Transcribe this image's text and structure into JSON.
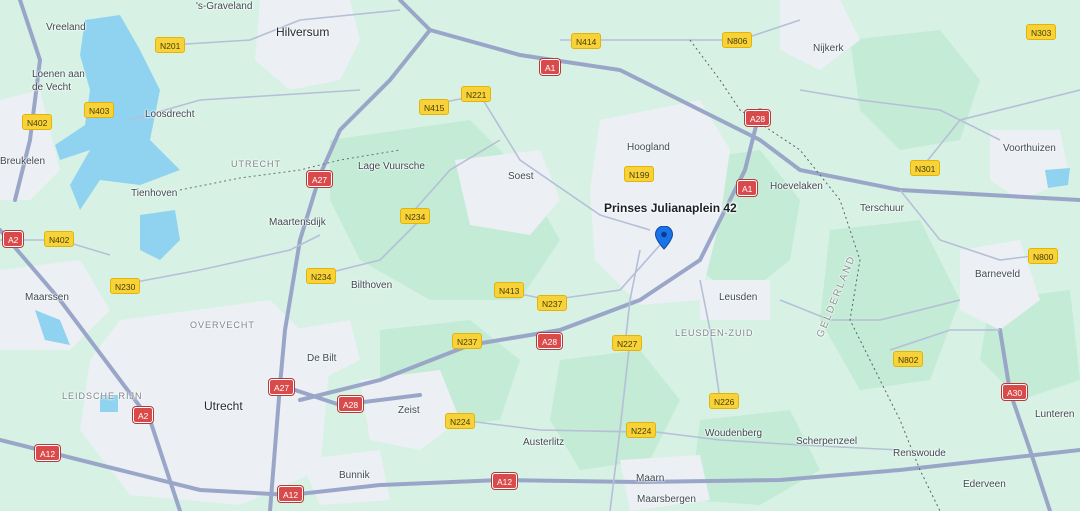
{
  "marker": {
    "label": "Prinses Julianaplein 42"
  },
  "places": [
    {
      "id": "vreeland",
      "text": "Vreeland",
      "cls": "lbl"
    },
    {
      "id": "graveland",
      "text": "'s-Graveland",
      "cls": "lbl"
    },
    {
      "id": "hilversum",
      "text": "Hilversum",
      "cls": "lbl city"
    },
    {
      "id": "nijkerk",
      "text": "Nijkerk",
      "cls": "lbl"
    },
    {
      "id": "loenen",
      "text": "Loenen aan\nde Vecht",
      "cls": "lbl"
    },
    {
      "id": "loosdrecht",
      "text": "Loosdrecht",
      "cls": "lbl"
    },
    {
      "id": "hoogland",
      "text": "Hoogland",
      "cls": "lbl"
    },
    {
      "id": "voorthuizen",
      "text": "Voorthuizen",
      "cls": "lbl"
    },
    {
      "id": "breukelen",
      "text": "Breukelen",
      "cls": "lbl"
    },
    {
      "id": "utrecht-prov",
      "text": "UTRECHT",
      "cls": "lbl region"
    },
    {
      "id": "lagevuursche",
      "text": "Lage Vuursche",
      "cls": "lbl"
    },
    {
      "id": "soest",
      "text": "Soest",
      "cls": "lbl"
    },
    {
      "id": "tienhoven",
      "text": "Tienhoven",
      "cls": "lbl"
    },
    {
      "id": "hoevelaken",
      "text": "Hoevelaken",
      "cls": "lbl"
    },
    {
      "id": "terschuur",
      "text": "Terschuur",
      "cls": "lbl"
    },
    {
      "id": "maartensdijk",
      "text": "Maartensdijk",
      "cls": "lbl"
    },
    {
      "id": "barneveld",
      "text": "Barneveld",
      "cls": "lbl"
    },
    {
      "id": "maarssen",
      "text": "Maarssen",
      "cls": "lbl"
    },
    {
      "id": "bilthoven",
      "text": "Bilthoven",
      "cls": "lbl"
    },
    {
      "id": "leusden",
      "text": "Leusden",
      "cls": "lbl"
    },
    {
      "id": "overvecht",
      "text": "OVERVECHT",
      "cls": "lbl region"
    },
    {
      "id": "leusdenzuid",
      "text": "LEUSDEN-ZUID",
      "cls": "lbl region"
    },
    {
      "id": "debilt",
      "text": "De Bilt",
      "cls": "lbl"
    },
    {
      "id": "leidscherijn",
      "text": "LEIDSCHE RIJN",
      "cls": "lbl region"
    },
    {
      "id": "utrecht",
      "text": "Utrecht",
      "cls": "lbl city"
    },
    {
      "id": "zeist",
      "text": "Zeist",
      "cls": "lbl"
    },
    {
      "id": "lunteren",
      "text": "Lunteren",
      "cls": "lbl"
    },
    {
      "id": "woudenberg",
      "text": "Woudenberg",
      "cls": "lbl"
    },
    {
      "id": "scherpenzeel",
      "text": "Scherpenzeel",
      "cls": "lbl"
    },
    {
      "id": "austerlitz",
      "text": "Austerlitz",
      "cls": "lbl"
    },
    {
      "id": "renswoude",
      "text": "Renswoude",
      "cls": "lbl"
    },
    {
      "id": "bunnik",
      "text": "Bunnik",
      "cls": "lbl"
    },
    {
      "id": "maarn",
      "text": "Maarn",
      "cls": "lbl"
    },
    {
      "id": "maarsbergen",
      "text": "Maarsbergen",
      "cls": "lbl"
    },
    {
      "id": "ederveen",
      "text": "Ederveen",
      "cls": "lbl"
    },
    {
      "id": "gelderland",
      "text": "GELDERLAND",
      "cls": "lbl prov"
    }
  ],
  "shields": [
    {
      "id": "s1",
      "text": "N201",
      "kind": "n"
    },
    {
      "id": "s2",
      "text": "N414",
      "kind": "n"
    },
    {
      "id": "s3",
      "text": "N806",
      "kind": "n"
    },
    {
      "id": "s4",
      "text": "N303",
      "kind": "n"
    },
    {
      "id": "s5",
      "text": "A1",
      "kind": "a"
    },
    {
      "id": "s6",
      "text": "N403",
      "kind": "n"
    },
    {
      "id": "s7",
      "text": "N221",
      "kind": "n"
    },
    {
      "id": "s8",
      "text": "N415",
      "kind": "n"
    },
    {
      "id": "s9",
      "text": "N402",
      "kind": "n"
    },
    {
      "id": "s10",
      "text": "A28",
      "kind": "a"
    },
    {
      "id": "s11",
      "text": "N199",
      "kind": "n"
    },
    {
      "id": "s12",
      "text": "N301",
      "kind": "n"
    },
    {
      "id": "s13",
      "text": "A27",
      "kind": "a"
    },
    {
      "id": "s14",
      "text": "A1",
      "kind": "a"
    },
    {
      "id": "s15",
      "text": "N234",
      "kind": "n"
    },
    {
      "id": "s16",
      "text": "A2",
      "kind": "a"
    },
    {
      "id": "s17",
      "text": "N402",
      "kind": "n"
    },
    {
      "id": "s18",
      "text": "N800",
      "kind": "n"
    },
    {
      "id": "s19",
      "text": "N234",
      "kind": "n"
    },
    {
      "id": "s20",
      "text": "N230",
      "kind": "n"
    },
    {
      "id": "s21",
      "text": "N413",
      "kind": "n"
    },
    {
      "id": "s22",
      "text": "N237",
      "kind": "n"
    },
    {
      "id": "s23",
      "text": "N237",
      "kind": "n"
    },
    {
      "id": "s24",
      "text": "A28",
      "kind": "a"
    },
    {
      "id": "s25",
      "text": "N227",
      "kind": "n"
    },
    {
      "id": "s26",
      "text": "N802",
      "kind": "n"
    },
    {
      "id": "s27",
      "text": "A27",
      "kind": "a"
    },
    {
      "id": "s28",
      "text": "A28",
      "kind": "a"
    },
    {
      "id": "s29",
      "text": "A30",
      "kind": "a"
    },
    {
      "id": "s30",
      "text": "N226",
      "kind": "n"
    },
    {
      "id": "s31",
      "text": "A2",
      "kind": "a"
    },
    {
      "id": "s32",
      "text": "N224",
      "kind": "n"
    },
    {
      "id": "s33",
      "text": "N224",
      "kind": "n"
    },
    {
      "id": "s34",
      "text": "A12",
      "kind": "a"
    },
    {
      "id": "s35",
      "text": "A12",
      "kind": "a"
    },
    {
      "id": "s36",
      "text": "A12",
      "kind": "a"
    }
  ],
  "colors": {
    "land": "#d7f2e4",
    "forest": "#bfe9d2",
    "urban": "#eef0f3",
    "water": "#8fd3f0",
    "highway": "#9aa6c8",
    "road": "#ffffff",
    "border": "#4a4f55",
    "marker": "#1a73e8"
  }
}
